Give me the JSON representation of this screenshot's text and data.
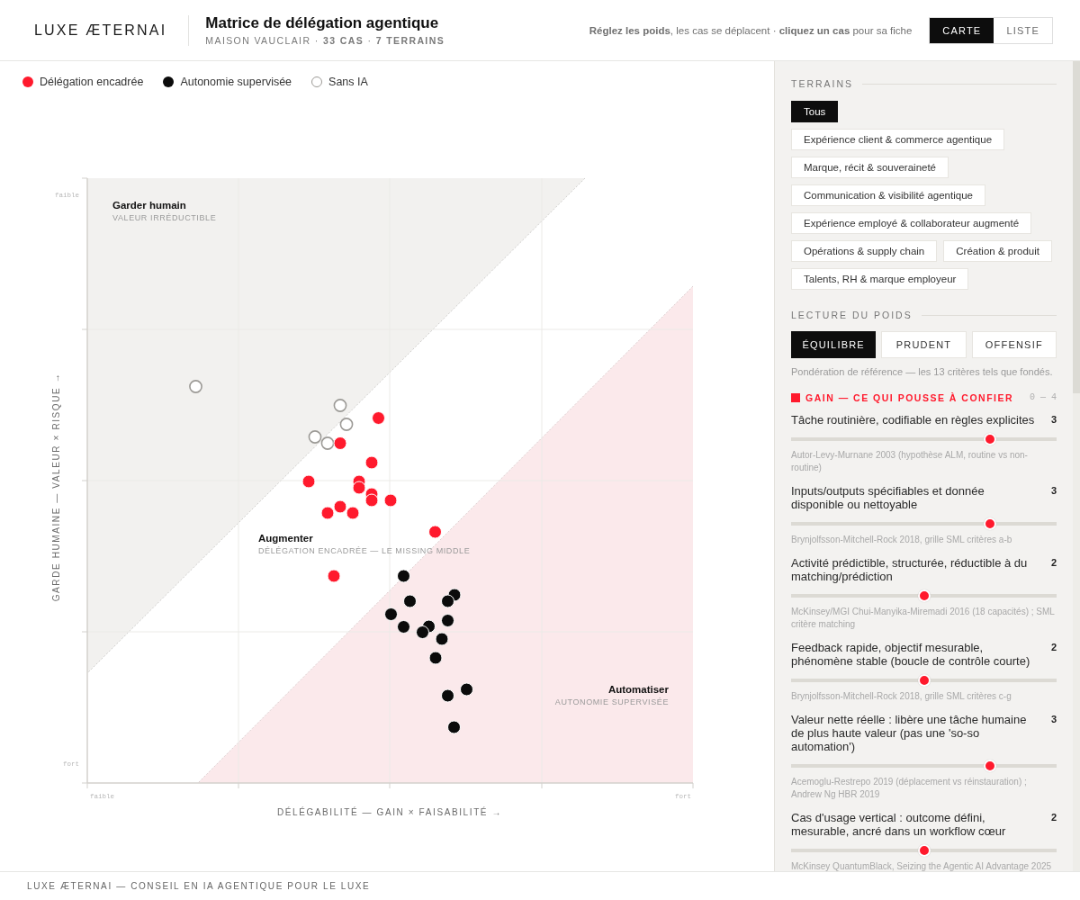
{
  "header": {
    "logo": "LUXE ÆTERNAI",
    "title": "Matrice de délégation agentique",
    "subtitle": "MAISON VAUCLAIR · **33 CAS** · **7 TERRAINS**",
    "hint": "**Réglez les poids**, les cas se déplacent · **cliquez un cas** pour sa fiche",
    "view_tabs": [
      {
        "label": "CARTE",
        "selected": true
      },
      {
        "label": "LISTE",
        "selected": false
      }
    ]
  },
  "legend": [
    {
      "label": "Délégation encadrée",
      "kind": "filled",
      "color": "#ff1a2d"
    },
    {
      "label": "Autonomie supervisée",
      "kind": "filled",
      "color": "#0b0b0b"
    },
    {
      "label": "Sans IA",
      "kind": "ring",
      "color": "#9c9a96"
    }
  ],
  "chart": {
    "quadrants": [
      {
        "title": "Garder humain",
        "subtitle": "VALEUR IRRÉDUCTIBLE"
      },
      {
        "title": "Augmenter",
        "subtitle": "DÉLÉGATION ENCADRÉE — LE MISSING MIDDLE"
      },
      {
        "title": "Automatiser",
        "subtitle": "AUTONOMIE SUPERVISÉE"
      }
    ],
    "x_axis": {
      "label": "DÉLÉGABILITÉ — GAIN × FAISABILITÉ →",
      "left_label": "faible",
      "right_label": "fort"
    },
    "y_axis": {
      "label": "GARDE HUMAINE — VALEUR × RISQUE →",
      "top_label": "faible",
      "bottom_label": "fort"
    }
  },
  "sidebar": {
    "terrains": {
      "title": "TERRAINS",
      "chips": [
        {
          "label": "Tous",
          "selected": true
        },
        {
          "label": "Expérience client & commerce agentique",
          "selected": false
        },
        {
          "label": "Marque, récit & souveraineté",
          "selected": false
        },
        {
          "label": "Communication & visibilité agentique",
          "selected": false
        },
        {
          "label": "Expérience employé & collaborateur augmenté",
          "selected": false
        },
        {
          "label": "Opérations & supply chain",
          "selected": false
        },
        {
          "label": "Création & produit",
          "selected": false
        },
        {
          "label": "Talents, RH & marque employeur",
          "selected": false
        }
      ]
    },
    "weighting": {
      "title": "LECTURE DU POIDS",
      "options": [
        {
          "label": "ÉQUILIBRE",
          "selected": true
        },
        {
          "label": "PRUDENT",
          "selected": false
        },
        {
          "label": "OFFENSIF",
          "selected": false
        }
      ],
      "description": "Pondération de référence — les 13 critères tels que fondés."
    },
    "group": {
      "title": "GAIN — CE QUI POUSSE À CONFIER",
      "range": "0 — 4",
      "criteria": [
        {
          "label": "Tâche routinière, codifiable en règles explicites",
          "value": "3",
          "level": 0.75,
          "source": "Autor-Levy-Murnane 2003 (hypothèse ALM, routine vs non-routine)"
        },
        {
          "label": "Inputs/outputs spécifiables et donnée disponible ou nettoyable",
          "value": "3",
          "level": 0.75,
          "source": "Brynjolfsson-Mitchell-Rock 2018, grille SML critères a-b"
        },
        {
          "label": "Activité prédictible, structurée, réductible à du matching/prédiction",
          "value": "2",
          "level": 0.5,
          "source": "McKinsey/MGI Chui-Manyika-Miremadi 2016 (18 capacités) ; SML critère matching"
        },
        {
          "label": "Feedback rapide, objectif mesurable, phénomène stable (boucle de contrôle courte)",
          "value": "2",
          "level": 0.5,
          "source": "Brynjolfsson-Mitchell-Rock 2018, grille SML critères c-g"
        },
        {
          "label": "Valeur nette réelle : libère une tâche humaine de plus haute valeur (pas une 'so-so automation')",
          "value": "3",
          "level": 0.75,
          "source": "Acemoglu-Restrepo 2019 (déplacement vs réinstauration) ; Andrew Ng HBR 2019"
        },
        {
          "label": "Cas d'usage vertical : outcome défini, mesurable, ancré dans un workflow cœur",
          "value": "2",
          "level": 0.5,
          "source": "McKinsey QuantumBlack, Seizing the Agentic AI Advantage 2025"
        }
      ]
    }
  },
  "footer": {
    "text": "LUXE ÆTERNAI — CONSEIL EN IA AGENTIQUE POUR LE LUXE"
  }
}
